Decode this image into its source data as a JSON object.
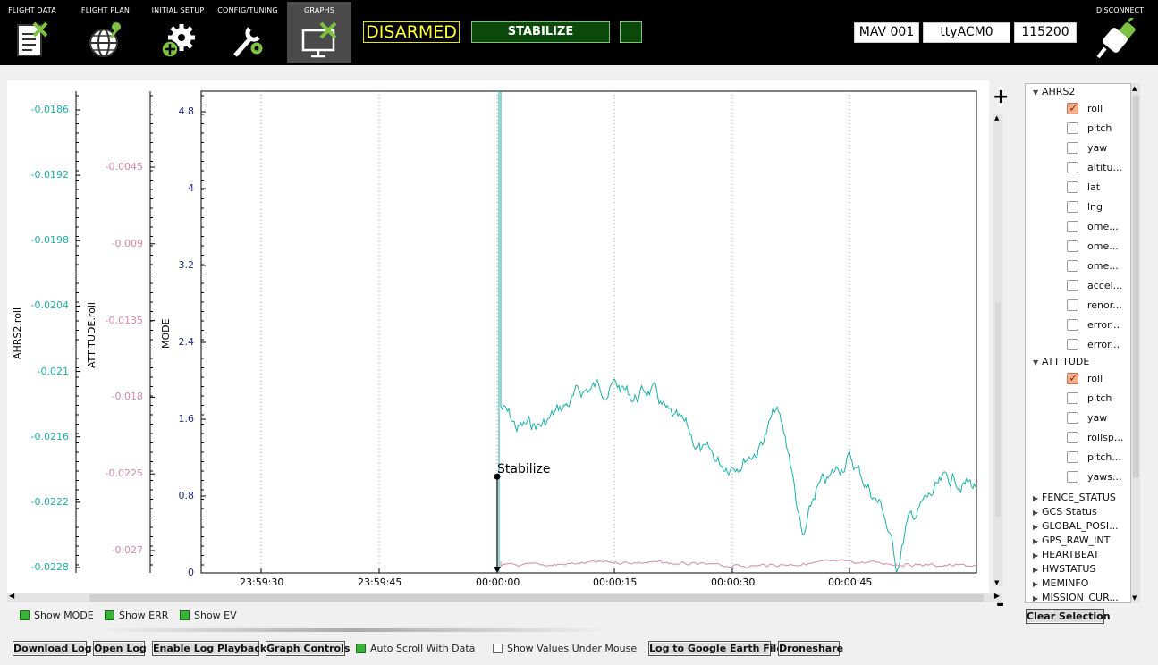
{
  "toolbar": {
    "nav": [
      {
        "label": "FLIGHT DATA",
        "icon": "clipboard-icon"
      },
      {
        "label": "FLIGHT PLAN",
        "icon": "globe-icon"
      },
      {
        "label": "INITIAL SETUP",
        "icon": "gear-plus-icon"
      },
      {
        "label": "CONFIG/TUNING",
        "icon": "wrench-gear-icon"
      },
      {
        "label": "GRAPHS",
        "icon": "monitor-icon"
      }
    ],
    "active_nav": "GRAPHS",
    "arm_status": "DISARMED",
    "flight_mode": "STABILIZE",
    "mav": "MAV 001",
    "port": "ttyACM0",
    "baud": "115200",
    "disconnect_label": "DISCONNECT",
    "colors": {
      "arm": "#ffff33",
      "mode_bg": "#0b4a0b"
    }
  },
  "chart_data": {
    "type": "line",
    "x_tick_labels": [
      "23:59:30",
      "23:59:45",
      "00:00:00",
      "00:00:15",
      "00:00:30",
      "00:00:45"
    ],
    "axes": [
      {
        "title": "AHRS2.roll",
        "color": "#18b3a8",
        "ticks": [
          "-0.0186",
          "-0.0192",
          "-0.0198",
          "-0.0204",
          "-0.021",
          "-0.0216",
          "-0.0222",
          "-0.0228"
        ]
      },
      {
        "title": "ATTITUDE.roll",
        "color": "#d78aa2",
        "ticks": [
          "-0.0045",
          "-0.009",
          "-0.0135",
          "-0.018",
          "-0.0225",
          "-0.027"
        ]
      },
      {
        "title": "MODE",
        "color": "#1c2a80",
        "ticks": [
          "4.8",
          "4",
          "3.2",
          "2.4",
          "1.6",
          "0.8",
          "0"
        ],
        "ylim": [
          0,
          5
        ]
      }
    ],
    "series": [
      {
        "name": "AHRS2.roll",
        "color": "#18b3a8",
        "axis": 0
      },
      {
        "name": "ATTITUDE.roll",
        "color": "#d78aa2",
        "axis": 1
      }
    ],
    "event": {
      "label": "Stabilize",
      "x": "00:00:00",
      "mode_value": 1.0
    },
    "grid": "vertical-dotted"
  },
  "tree": {
    "groups": [
      {
        "name": "AHRS2",
        "expanded": true,
        "items": [
          {
            "label": "roll",
            "checked": true
          },
          {
            "label": "pitch",
            "checked": false
          },
          {
            "label": "yaw",
            "checked": false
          },
          {
            "label": "altitu...",
            "checked": false
          },
          {
            "label": "lat",
            "checked": false
          },
          {
            "label": "lng",
            "checked": false
          },
          {
            "label": "ome...",
            "checked": false
          },
          {
            "label": "ome...",
            "checked": false
          },
          {
            "label": "ome...",
            "checked": false
          },
          {
            "label": "accel...",
            "checked": false
          },
          {
            "label": "renor...",
            "checked": false
          },
          {
            "label": "error...",
            "checked": false
          },
          {
            "label": "error...",
            "checked": false
          }
        ]
      },
      {
        "name": "ATTITUDE",
        "expanded": true,
        "items": [
          {
            "label": "roll",
            "checked": true
          },
          {
            "label": "pitch",
            "checked": false
          },
          {
            "label": "yaw",
            "checked": false
          },
          {
            "label": "rollsp...",
            "checked": false
          },
          {
            "label": "pitch...",
            "checked": false
          },
          {
            "label": "yaws...",
            "checked": false
          }
        ]
      }
    ],
    "collapsed": [
      "FENCE_STATUS",
      "GCS Status",
      "GLOBAL_POSI...",
      "GPS_RAW_INT",
      "HEARTBEAT",
      "HWSTATUS",
      "MEMINFO",
      "MISSION_CUR..."
    ]
  },
  "controls": {
    "zoom_in": "+",
    "zoom_out": "-",
    "clear_selection": "Clear Selection",
    "show_mode": "Show MODE",
    "show_err": "Show ERR",
    "show_ev": "Show EV",
    "download_log": "Download Log",
    "open_log": "Open Log",
    "enable_playback": "Enable Log Playback",
    "graph_controls": "Graph Controls",
    "auto_scroll": "Auto Scroll With Data",
    "show_values": "Show Values Under Mouse",
    "google_earth": "Log to Google Earth File",
    "droneshare": "Droneshare"
  }
}
